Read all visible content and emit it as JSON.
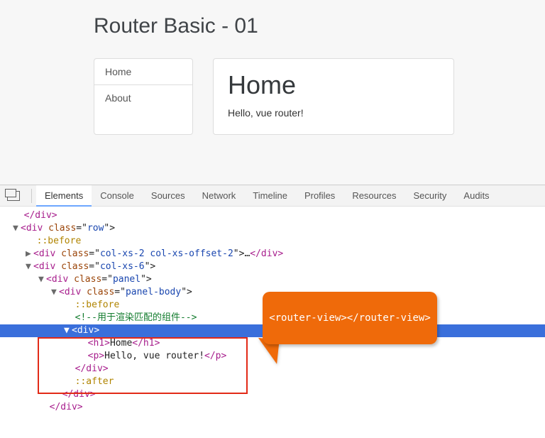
{
  "page": {
    "title": "Router Basic - 01"
  },
  "nav": {
    "items": [
      "Home",
      "About"
    ]
  },
  "content": {
    "heading": "Home",
    "text": "Hello, vue router!"
  },
  "devtools": {
    "tabs": [
      "Elements",
      "Console",
      "Sources",
      "Network",
      "Timeline",
      "Profiles",
      "Resources",
      "Security",
      "Audits"
    ],
    "active_tab": 0,
    "callout": "<router-view></router-view>",
    "tree": {
      "l0": "</div>",
      "l1a": "<div",
      "l1b": " class",
      "l1c": "=\"",
      "l1d": "row",
      "l1e": "\">",
      "l2": "::before",
      "l3a": "<div",
      "l3b": " class",
      "l3c": "=\"",
      "l3d": "col-xs-2 col-xs-offset-2",
      "l3e": "\">",
      "l3f": "…",
      "l3g": "</div>",
      "l4a": "<div",
      "l4b": " class",
      "l4c": "=\"",
      "l4d": "col-xs-6",
      "l4e": "\">",
      "l5a": "<div",
      "l5b": " class",
      "l5c": "=\"",
      "l5d": "panel",
      "l5e": "\">",
      "l6a": "<div",
      "l6b": " class",
      "l6c": "=\"",
      "l6d": "panel-body",
      "l6e": "\">",
      "l7": "::before",
      "l8": "<!--用于渲染匹配的组件-->",
      "l9a": "<",
      "l9b": "div",
      "l9c": ">",
      "l10a": "<h1>",
      "l10b": "Home",
      "l10c": "</h1>",
      "l11a": "<p>",
      "l11b": "Hello, vue router!",
      "l11c": "</p>",
      "l12": "</div>",
      "l13": "::after",
      "l14": "</div>",
      "l15": "</div>"
    }
  }
}
